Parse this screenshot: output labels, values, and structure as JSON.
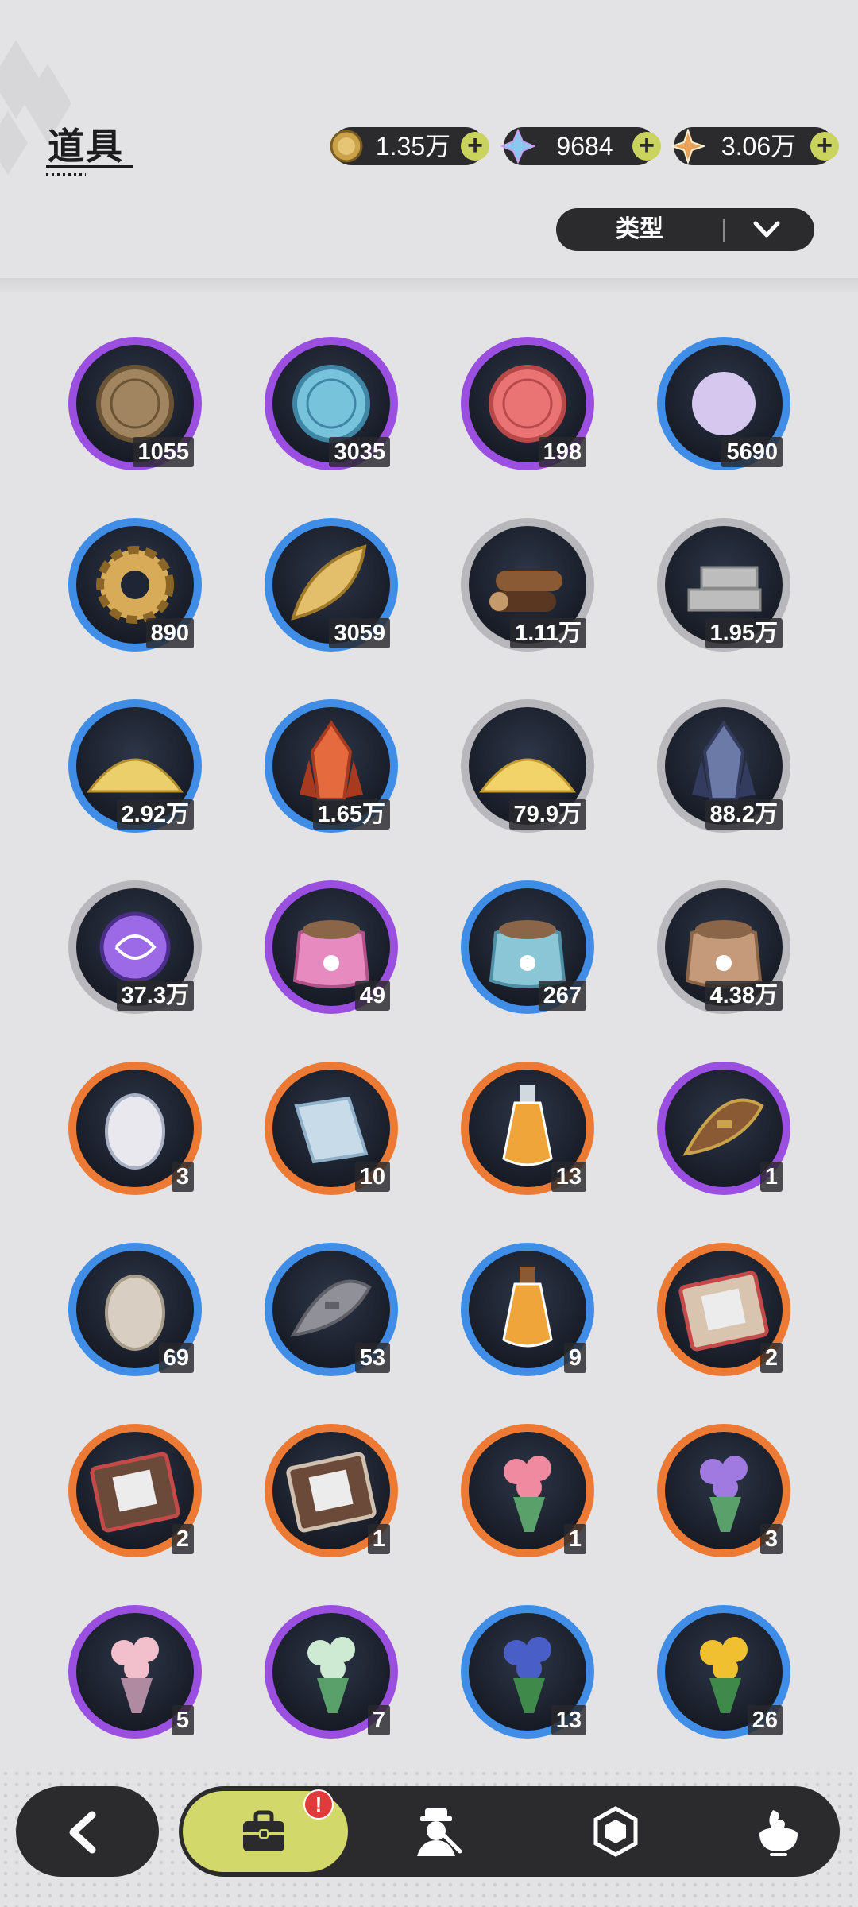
{
  "header": {
    "title": "道具"
  },
  "currencies": [
    {
      "name": "gold-coin",
      "value": "1.35万",
      "color": "#c9a24a"
    },
    {
      "name": "crystal",
      "value": "9684",
      "color": "#7fb6e8"
    },
    {
      "name": "star-gem",
      "value": "3.06万",
      "color": "#e8a25a"
    }
  ],
  "filter": {
    "label": "类型"
  },
  "items": [
    {
      "icon": "fist-medal-icon",
      "count": "1055",
      "rarity": "purple"
    },
    {
      "icon": "blue-emblem-medal-icon",
      "count": "3035",
      "rarity": "purple"
    },
    {
      "icon": "heart-medal-icon",
      "count": "198",
      "rarity": "purple"
    },
    {
      "icon": "scale-gem-icon",
      "count": "5690",
      "rarity": "blue"
    },
    {
      "icon": "gear-icon",
      "count": "890",
      "rarity": "blue"
    },
    {
      "icon": "golden-leaf-icon",
      "count": "3059",
      "rarity": "blue"
    },
    {
      "icon": "wood-logs-icon",
      "count": "1.11万",
      "rarity": "gray"
    },
    {
      "icon": "stone-bricks-icon",
      "count": "1.95万",
      "rarity": "gray"
    },
    {
      "icon": "gold-dust-icon",
      "count": "2.92万",
      "rarity": "blue"
    },
    {
      "icon": "red-crystal-icon",
      "count": "1.65万",
      "rarity": "blue"
    },
    {
      "icon": "gold-sand-pile-icon",
      "count": "79.9万",
      "rarity": "gray"
    },
    {
      "icon": "dark-crystal-icon",
      "count": "88.2万",
      "rarity": "gray"
    },
    {
      "icon": "purple-orb-icon",
      "count": "37.3万",
      "rarity": "gray"
    },
    {
      "icon": "pink-food-bag-icon",
      "count": "49",
      "rarity": "purple"
    },
    {
      "icon": "blue-food-bag-icon",
      "count": "267",
      "rarity": "blue"
    },
    {
      "icon": "brown-food-bag-icon",
      "count": "4.38万",
      "rarity": "gray"
    },
    {
      "icon": "patterned-egg-icon",
      "count": "3",
      "rarity": "orange"
    },
    {
      "icon": "cloth-roll-icon",
      "count": "10",
      "rarity": "orange"
    },
    {
      "icon": "orange-potion-icon",
      "count": "13",
      "rarity": "orange"
    },
    {
      "icon": "brown-feather-bundle-icon",
      "count": "1",
      "rarity": "purple"
    },
    {
      "icon": "plain-egg-icon",
      "count": "69",
      "rarity": "blue"
    },
    {
      "icon": "gray-feather-bundle-icon",
      "count": "53",
      "rarity": "blue"
    },
    {
      "icon": "small-potion-icon",
      "count": "9",
      "rarity": "blue"
    },
    {
      "icon": "photo-gift-box-icon",
      "count": "2",
      "rarity": "orange"
    },
    {
      "icon": "portrait-gift-box-icon",
      "count": "2",
      "rarity": "orange"
    },
    {
      "icon": "cat-gift-box-icon",
      "count": "1",
      "rarity": "orange"
    },
    {
      "icon": "pink-flower-bouquet-icon",
      "count": "1",
      "rarity": "orange"
    },
    {
      "icon": "purple-flower-bouquet-icon",
      "count": "3",
      "rarity": "orange"
    },
    {
      "icon": "cherry-blossom-bouquet-icon",
      "count": "5",
      "rarity": "purple"
    },
    {
      "icon": "green-flower-bouquet-icon",
      "count": "7",
      "rarity": "purple"
    },
    {
      "icon": "blue-iris-bouquet-icon",
      "count": "13",
      "rarity": "blue"
    },
    {
      "icon": "sunflower-bouquet-icon",
      "count": "26",
      "rarity": "blue"
    }
  ],
  "rarity_colors": {
    "purple": "#9b4fe0",
    "blue": "#3f8de6",
    "gray": "#b8b8bc",
    "orange": "#ec7a35"
  },
  "nav": {
    "back_icon": "back-arrow-icon",
    "tabs": [
      {
        "icon": "bag-icon",
        "active": true,
        "badge": "!"
      },
      {
        "icon": "character-icon",
        "active": false
      },
      {
        "icon": "gem-icon",
        "active": false
      },
      {
        "icon": "food-icon",
        "active": false
      }
    ]
  }
}
